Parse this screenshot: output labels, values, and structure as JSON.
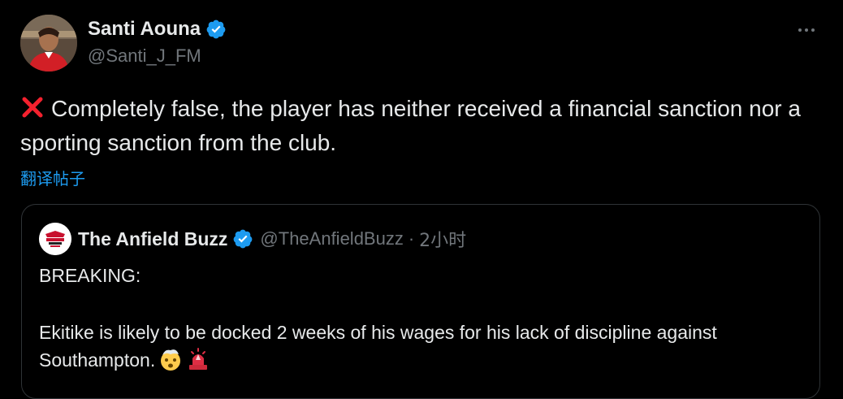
{
  "tweet": {
    "author_name": "Santi Aouna",
    "author_handle": "@Santi_J_FM",
    "text": "Completely false, the player has neither received a financial sanction nor a sporting sanction from the club.",
    "translate_label": "翻译帖子",
    "more_icon": "more-horizontal-icon",
    "verified_icon": "verified-badge-icon",
    "verified_color": "#1d9bf0"
  },
  "quote": {
    "author_name": "The Anfield Buzz",
    "author_handle": "@TheAnfieldBuzz",
    "separator": "·",
    "time": "2小时",
    "lines": [
      "BREAKING:",
      "Ekitike is likely to be docked 2 weeks of his wages for his lack of discipline against Southampton."
    ],
    "emojis": [
      "exploding-head-emoji",
      "police-light-emoji"
    ]
  },
  "colors": {
    "background": "#000000",
    "text_primary": "#e7e9ea",
    "text_secondary": "#71767b",
    "link": "#1d9bf0",
    "border": "#2f3336",
    "cross": "#f4212e"
  }
}
